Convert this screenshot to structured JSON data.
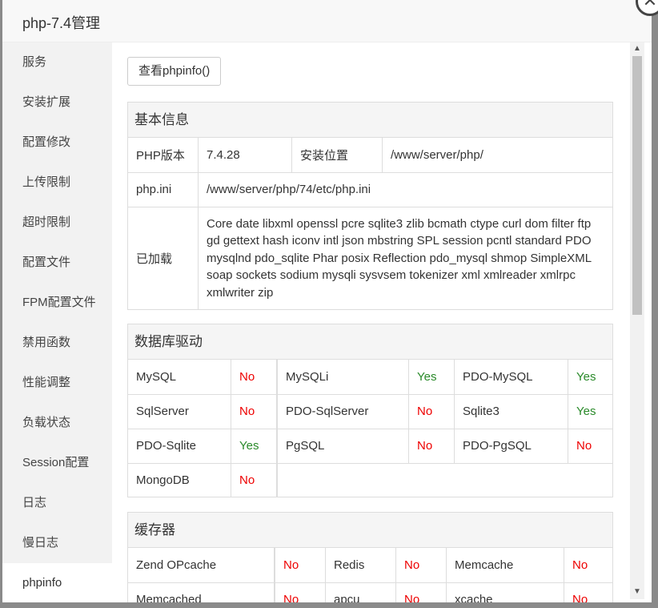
{
  "dialog": {
    "title": "php-7.4管理",
    "close_icon": "✕"
  },
  "sidebar": {
    "items": [
      {
        "label": "服务"
      },
      {
        "label": "安装扩展"
      },
      {
        "label": "配置修改"
      },
      {
        "label": "上传限制"
      },
      {
        "label": "超时限制"
      },
      {
        "label": "配置文件"
      },
      {
        "label": "FPM配置文件"
      },
      {
        "label": "禁用函数"
      },
      {
        "label": "性能调整"
      },
      {
        "label": "负载状态"
      },
      {
        "label": "Session配置"
      },
      {
        "label": "日志"
      },
      {
        "label": "慢日志"
      },
      {
        "label": "phpinfo"
      }
    ],
    "active": "phpinfo"
  },
  "content": {
    "phpinfo_button": "查看phpinfo()",
    "basic": {
      "title": "基本信息",
      "php_version_label": "PHP版本",
      "php_version": "7.4.28",
      "install_path_label": "安装位置",
      "install_path": "/www/server/php/",
      "ini_label": "php.ini",
      "ini_path": "/www/server/php/74/etc/php.ini",
      "loaded_label": "已加载",
      "loaded": "Core date libxml openssl pcre sqlite3 zlib bcmath ctype curl dom filter ftp gd gettext hash iconv intl json mbstring SPL session pcntl standard PDO mysqlnd pdo_sqlite Phar posix Reflection pdo_mysql shmop SimpleXML soap sockets sodium mysqli sysvsem tokenizer xml xmlreader xmlrpc xmlwriter zip"
    },
    "db": {
      "title": "数据库驱动",
      "rows": [
        [
          {
            "name": "MySQL",
            "status": "No"
          },
          {
            "name": "MySQLi",
            "status": "Yes"
          },
          {
            "name": "PDO-MySQL",
            "status": "Yes"
          }
        ],
        [
          {
            "name": "SqlServer",
            "status": "No"
          },
          {
            "name": "PDO-SqlServer",
            "status": "No"
          },
          {
            "name": "Sqlite3",
            "status": "Yes"
          }
        ],
        [
          {
            "name": "PDO-Sqlite",
            "status": "Yes"
          },
          {
            "name": "PgSQL",
            "status": "No"
          },
          {
            "name": "PDO-PgSQL",
            "status": "No"
          }
        ],
        [
          {
            "name": "MongoDB",
            "status": "No"
          }
        ]
      ]
    },
    "cache": {
      "title": "缓存器",
      "rows": [
        [
          {
            "name": "Zend OPcache",
            "status": "No"
          },
          {
            "name": "Redis",
            "status": "No"
          },
          {
            "name": "Memcache",
            "status": "No"
          }
        ],
        [
          {
            "name": "Memcached",
            "status": "No"
          },
          {
            "name": "apcu",
            "status": "No"
          },
          {
            "name": "xcache",
            "status": "No"
          }
        ]
      ]
    }
  },
  "colors": {
    "no": "#e00000",
    "yes": "#2a8a2a"
  }
}
